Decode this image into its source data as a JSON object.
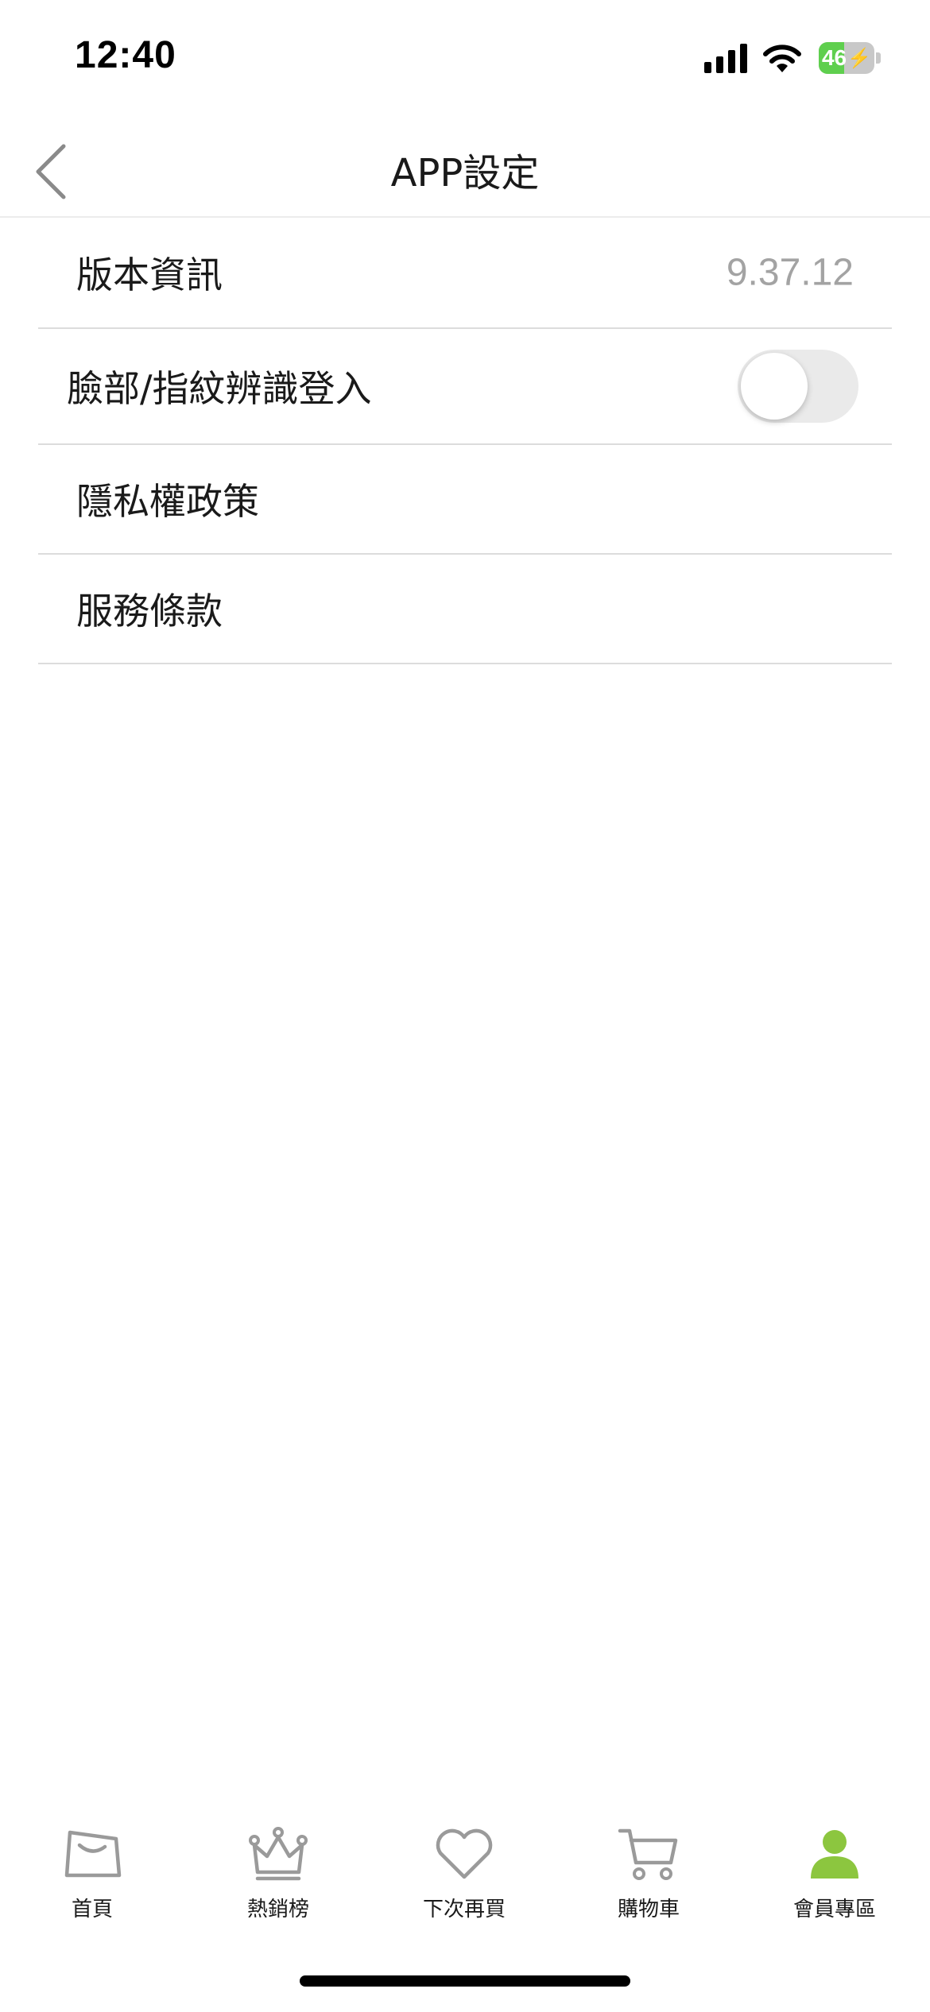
{
  "status_bar": {
    "time": "12:40",
    "battery_level": "46",
    "battery_fraction": 0.46,
    "icons": [
      "signal-icon",
      "wifi-icon",
      "battery-charging-icon"
    ]
  },
  "nav": {
    "title": "APP設定",
    "back_icon": "chevron-left-icon"
  },
  "settings": {
    "version": {
      "label": "版本資訊",
      "value": "9.37.12"
    },
    "biometric": {
      "label": "臉部/指紋辨識登入",
      "enabled": false
    },
    "privacy": {
      "label": "隱私權政策"
    },
    "terms": {
      "label": "服務條款"
    }
  },
  "tabs": [
    {
      "label": "首頁",
      "icon": "shopping-bag-icon",
      "active": false
    },
    {
      "label": "熱銷榜",
      "icon": "crown-icon",
      "active": false
    },
    {
      "label": "下次再買",
      "icon": "heart-icon",
      "active": false
    },
    {
      "label": "購物車",
      "icon": "cart-icon",
      "active": false
    },
    {
      "label": "會員專區",
      "icon": "member-icon",
      "active": true
    }
  ],
  "colors": {
    "accent_green": "#8cc63f",
    "icon_gray": "#9a9a9a",
    "value_gray": "#a3a3a3",
    "toggle_off": "#eaeaea",
    "battery_green": "#5fcf4e"
  }
}
